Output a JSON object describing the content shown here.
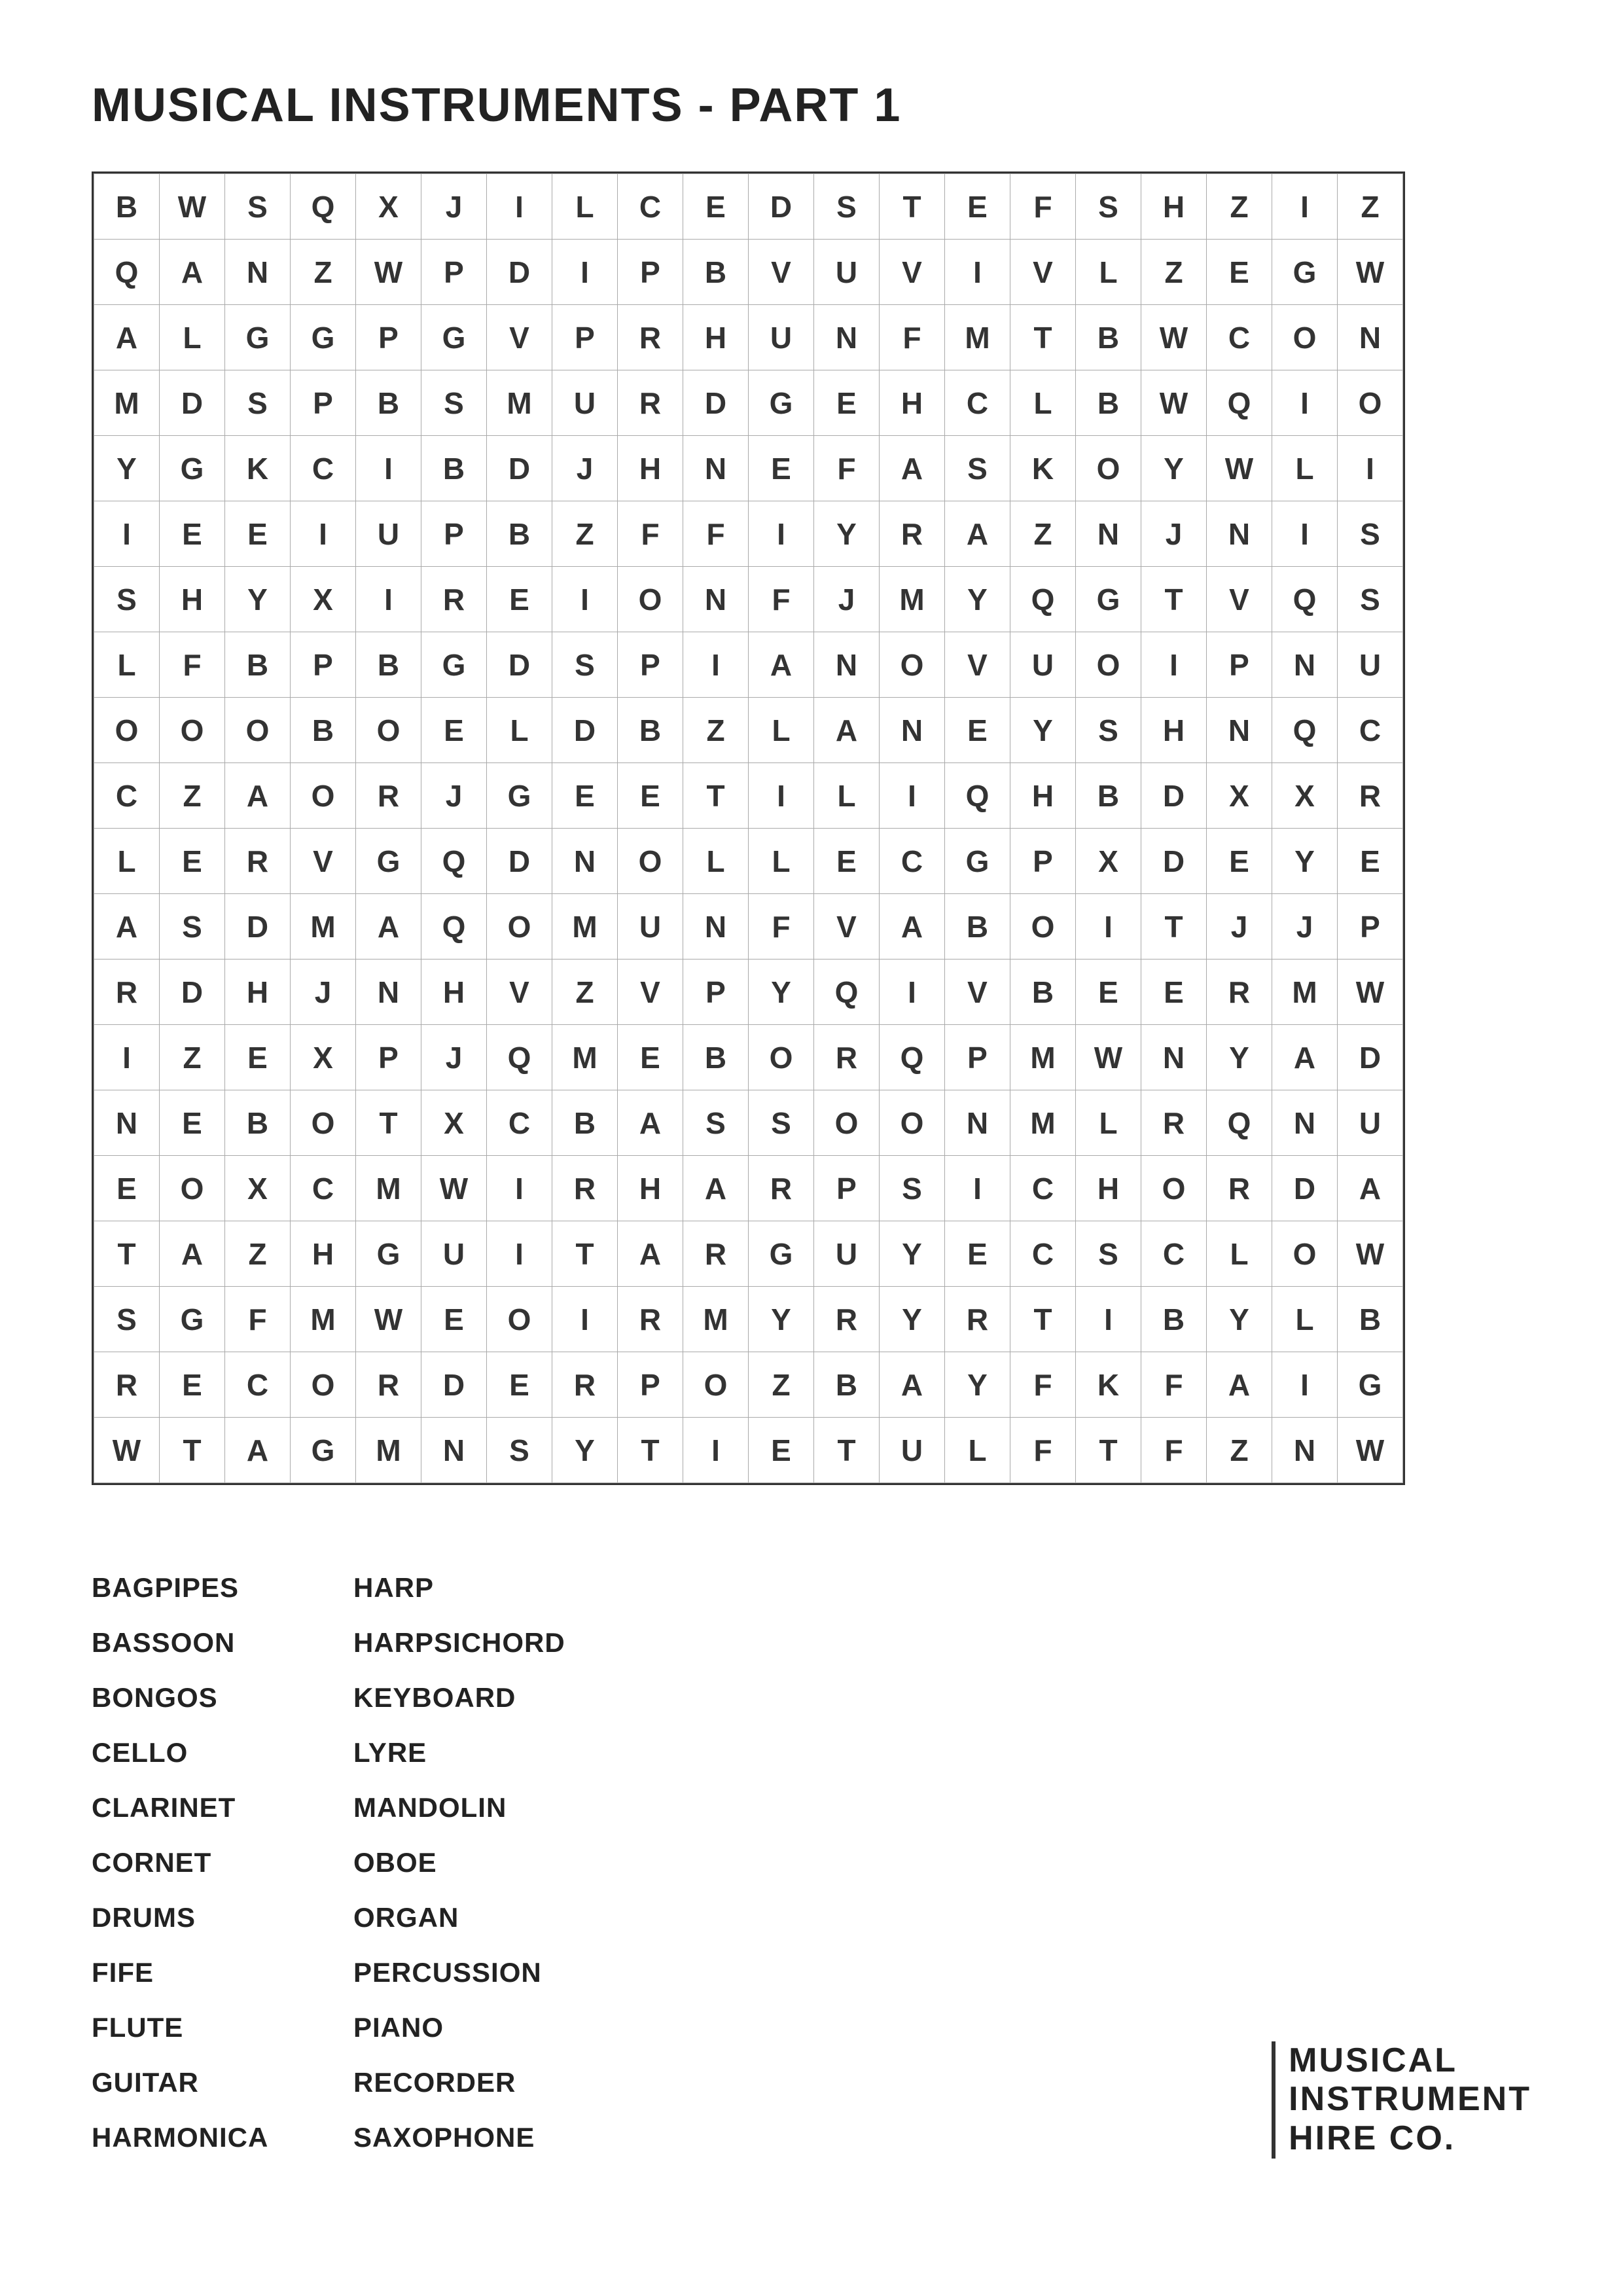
{
  "title": "MUSICAL INSTRUMENTS - PART 1",
  "grid": [
    [
      "B",
      "W",
      "S",
      "Q",
      "X",
      "J",
      "I",
      "L",
      "C",
      "E",
      "D",
      "S",
      "T",
      "E",
      "F",
      "S",
      "H",
      "Z",
      "I",
      "Z"
    ],
    [
      "Q",
      "A",
      "N",
      "Z",
      "W",
      "P",
      "D",
      "I",
      "P",
      "B",
      "V",
      "U",
      "V",
      "I",
      "V",
      "L",
      "Z",
      "E",
      "G",
      "W"
    ],
    [
      "A",
      "L",
      "G",
      "G",
      "P",
      "G",
      "V",
      "P",
      "R",
      "H",
      "U",
      "N",
      "F",
      "M",
      "T",
      "B",
      "W",
      "C",
      "O",
      "N"
    ],
    [
      "M",
      "D",
      "S",
      "P",
      "B",
      "S",
      "M",
      "U",
      "R",
      "D",
      "G",
      "E",
      "H",
      "C",
      "L",
      "B",
      "W",
      "Q",
      "I",
      "O"
    ],
    [
      "Y",
      "G",
      "K",
      "C",
      "I",
      "B",
      "D",
      "J",
      "H",
      "N",
      "E",
      "F",
      "A",
      "S",
      "K",
      "O",
      "Y",
      "W",
      "L",
      "I"
    ],
    [
      "I",
      "E",
      "E",
      "I",
      "U",
      "P",
      "B",
      "Z",
      "F",
      "F",
      "I",
      "Y",
      "R",
      "A",
      "Z",
      "N",
      "J",
      "N",
      "I",
      "S"
    ],
    [
      "S",
      "H",
      "Y",
      "X",
      "I",
      "R",
      "E",
      "I",
      "O",
      "N",
      "F",
      "J",
      "M",
      "Y",
      "Q",
      "G",
      "T",
      "V",
      "Q",
      "S"
    ],
    [
      "L",
      "F",
      "B",
      "P",
      "B",
      "G",
      "D",
      "S",
      "P",
      "I",
      "A",
      "N",
      "O",
      "V",
      "U",
      "O",
      "I",
      "P",
      "N",
      "U"
    ],
    [
      "O",
      "O",
      "O",
      "B",
      "O",
      "E",
      "L",
      "D",
      "B",
      "Z",
      "L",
      "A",
      "N",
      "E",
      "Y",
      "S",
      "H",
      "N",
      "Q",
      "C"
    ],
    [
      "C",
      "Z",
      "A",
      "O",
      "R",
      "J",
      "G",
      "E",
      "E",
      "T",
      "I",
      "L",
      "I",
      "Q",
      "H",
      "B",
      "D",
      "X",
      "X",
      "R"
    ],
    [
      "L",
      "E",
      "R",
      "V",
      "G",
      "Q",
      "D",
      "N",
      "O",
      "L",
      "L",
      "E",
      "C",
      "G",
      "P",
      "X",
      "D",
      "E",
      "Y",
      "E"
    ],
    [
      "A",
      "S",
      "D",
      "M",
      "A",
      "Q",
      "O",
      "M",
      "U",
      "N",
      "F",
      "V",
      "A",
      "B",
      "O",
      "I",
      "T",
      "J",
      "J",
      "P"
    ],
    [
      "R",
      "D",
      "H",
      "J",
      "N",
      "H",
      "V",
      "Z",
      "V",
      "P",
      "Y",
      "Q",
      "I",
      "V",
      "B",
      "E",
      "E",
      "R",
      "M",
      "W"
    ],
    [
      "I",
      "Z",
      "E",
      "X",
      "P",
      "J",
      "Q",
      "M",
      "E",
      "B",
      "O",
      "R",
      "Q",
      "P",
      "M",
      "W",
      "N",
      "Y",
      "A",
      "D"
    ],
    [
      "N",
      "E",
      "B",
      "O",
      "T",
      "X",
      "C",
      "B",
      "A",
      "S",
      "S",
      "O",
      "O",
      "N",
      "M",
      "L",
      "R",
      "Q",
      "N",
      "U"
    ],
    [
      "E",
      "O",
      "X",
      "C",
      "M",
      "W",
      "I",
      "R",
      "H",
      "A",
      "R",
      "P",
      "S",
      "I",
      "C",
      "H",
      "O",
      "R",
      "D",
      "A"
    ],
    [
      "T",
      "A",
      "Z",
      "H",
      "G",
      "U",
      "I",
      "T",
      "A",
      "R",
      "G",
      "U",
      "Y",
      "E",
      "C",
      "S",
      "C",
      "L",
      "O",
      "W"
    ],
    [
      "S",
      "G",
      "F",
      "M",
      "W",
      "E",
      "O",
      "I",
      "R",
      "M",
      "Y",
      "R",
      "Y",
      "R",
      "T",
      "I",
      "B",
      "Y",
      "L",
      "B"
    ],
    [
      "R",
      "E",
      "C",
      "O",
      "R",
      "D",
      "E",
      "R",
      "P",
      "O",
      "Z",
      "B",
      "A",
      "Y",
      "F",
      "K",
      "F",
      "A",
      "I",
      "G"
    ],
    [
      "W",
      "T",
      "A",
      "G",
      "M",
      "N",
      "S",
      "Y",
      "T",
      "I",
      "E",
      "T",
      "U",
      "L",
      "F",
      "T",
      "F",
      "Z",
      "N",
      "W"
    ]
  ],
  "word_list_col1": [
    "BAGPIPES",
    "BASSOON",
    "BONGOS",
    "CELLO",
    "CLARINET",
    "CORNET",
    "DRUMS",
    "FIFE",
    "FLUTE",
    "GUITAR",
    "HARMONICA"
  ],
  "word_list_col2": [
    "HARP",
    "HARPSICHORD",
    "KEYBOARD",
    "LYRE",
    "MANDOLIN",
    "OBOE",
    "ORGAN",
    "PERCUSSION",
    "PIANO",
    "RECORDER",
    "SAXOPHONE"
  ],
  "logo": {
    "line1": "MUSICAL",
    "line2": "INSTRUMENT",
    "line3": "HIRE CO."
  }
}
